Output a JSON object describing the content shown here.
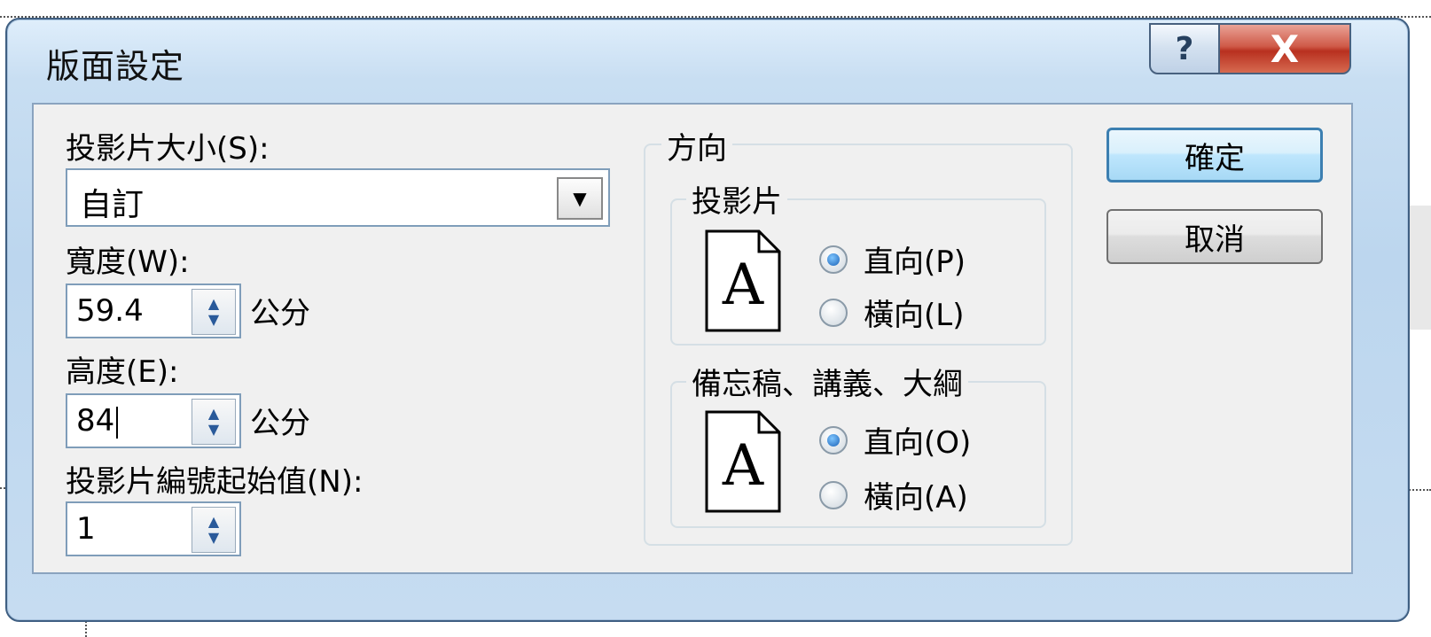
{
  "dialog": {
    "title": "版面設定",
    "help_button": "?",
    "close_button": "X"
  },
  "left": {
    "slide_size_label": "投影片大小(S):",
    "slide_size_value": "自訂",
    "width_label": "寬度(W):",
    "width_value": "59.4",
    "height_label": "高度(E):",
    "height_value": "84",
    "unit": "公分",
    "start_number_label": "投影片編號起始值(N):",
    "start_number_value": "1"
  },
  "orientation": {
    "group_label": "方向",
    "slides": {
      "label": "投影片",
      "portrait": "直向(P)",
      "landscape": "橫向(L)",
      "selected": "portrait"
    },
    "notes": {
      "label": "備忘稿、講義、大綱",
      "portrait": "直向(O)",
      "landscape": "橫向(A)",
      "selected": "portrait"
    }
  },
  "buttons": {
    "ok": "確定",
    "cancel": "取消"
  }
}
